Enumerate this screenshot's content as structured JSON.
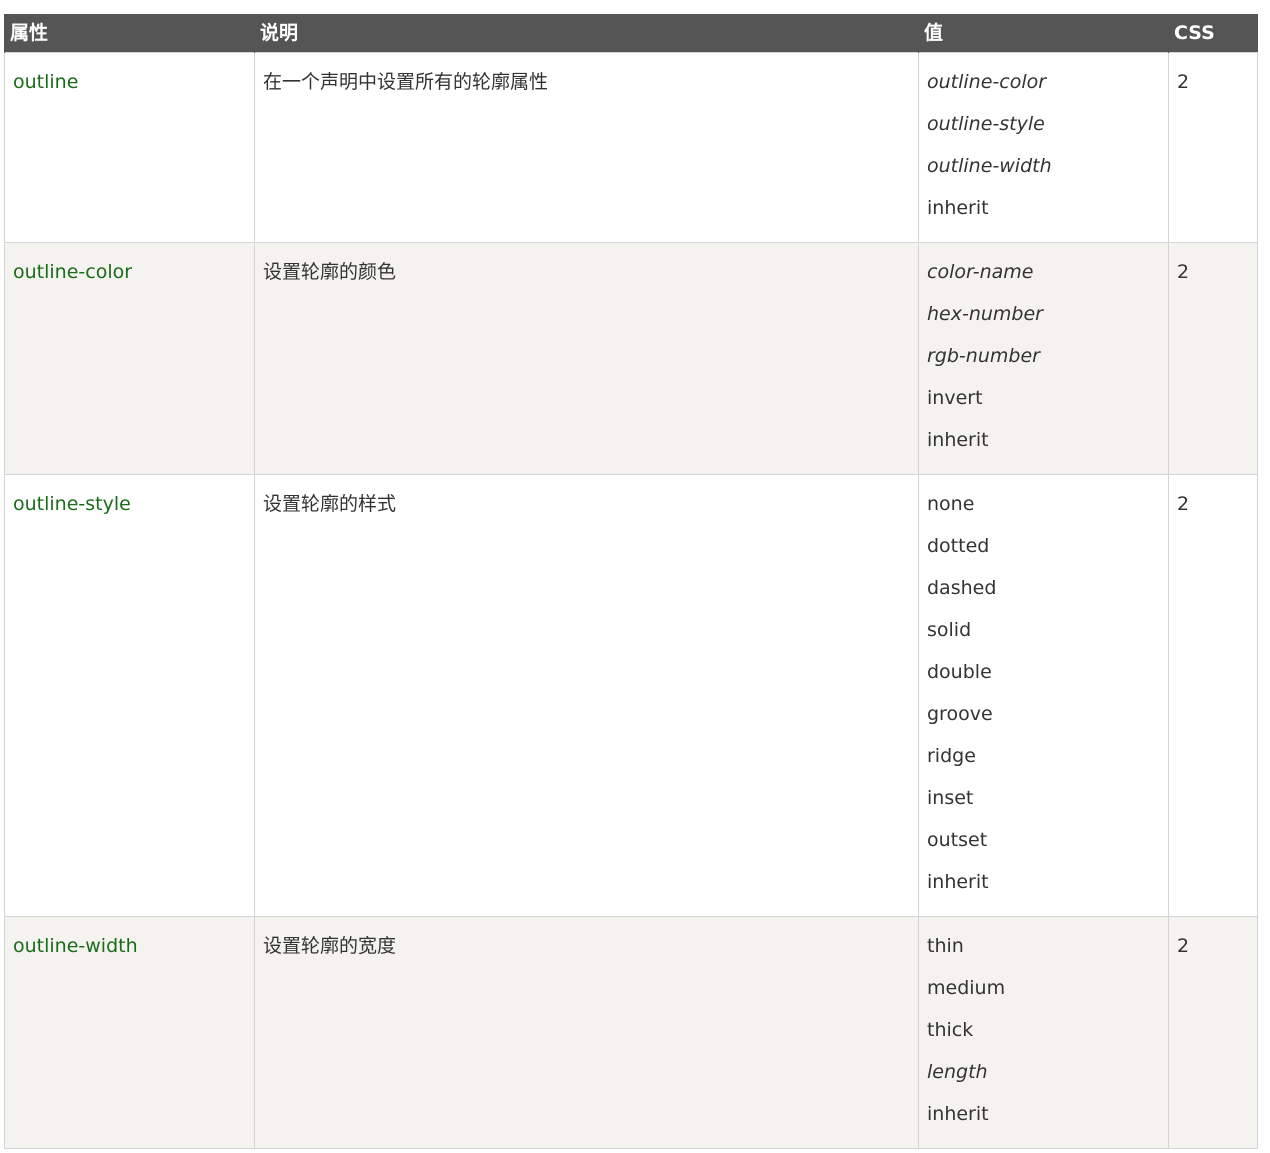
{
  "table": {
    "headers": [
      "属性",
      "说明",
      "值",
      "CSS"
    ],
    "rows": [
      {
        "property": "outline",
        "description": "在一个声明中设置所有的轮廓属性",
        "values": [
          {
            "text": "outline-color",
            "italic": true
          },
          {
            "text": "outline-style",
            "italic": true
          },
          {
            "text": "outline-width",
            "italic": true
          },
          {
            "text": "inherit",
            "italic": false
          }
        ],
        "css": "2"
      },
      {
        "property": "outline-color",
        "description": "设置轮廓的颜色",
        "values": [
          {
            "text": "color-name",
            "italic": true
          },
          {
            "text": "hex-number",
            "italic": true
          },
          {
            "text": "rgb-number",
            "italic": true
          },
          {
            "text": "invert",
            "italic": false
          },
          {
            "text": "inherit",
            "italic": false
          }
        ],
        "css": "2"
      },
      {
        "property": "outline-style",
        "description": "设置轮廓的样式",
        "values": [
          {
            "text": "none",
            "italic": false
          },
          {
            "text": "dotted",
            "italic": false
          },
          {
            "text": "dashed",
            "italic": false
          },
          {
            "text": "solid",
            "italic": false
          },
          {
            "text": "double",
            "italic": false
          },
          {
            "text": "groove",
            "italic": false
          },
          {
            "text": "ridge",
            "italic": false
          },
          {
            "text": "inset",
            "italic": false
          },
          {
            "text": "outset",
            "italic": false
          },
          {
            "text": "inherit",
            "italic": false
          }
        ],
        "css": "2"
      },
      {
        "property": "outline-width",
        "description": "设置轮廓的宽度",
        "values": [
          {
            "text": "thin",
            "italic": false
          },
          {
            "text": "medium",
            "italic": false
          },
          {
            "text": "thick",
            "italic": false
          },
          {
            "text": "length",
            "italic": true
          },
          {
            "text": "inherit",
            "italic": false
          }
        ],
        "css": "2"
      }
    ]
  },
  "colors": {
    "header_bg": "#555555",
    "header_text": "#ffffff",
    "property_link": "#1a6b1a",
    "alt_row_bg": "#f4f3f0",
    "border": "#d4d4d4",
    "text": "#333333"
  }
}
